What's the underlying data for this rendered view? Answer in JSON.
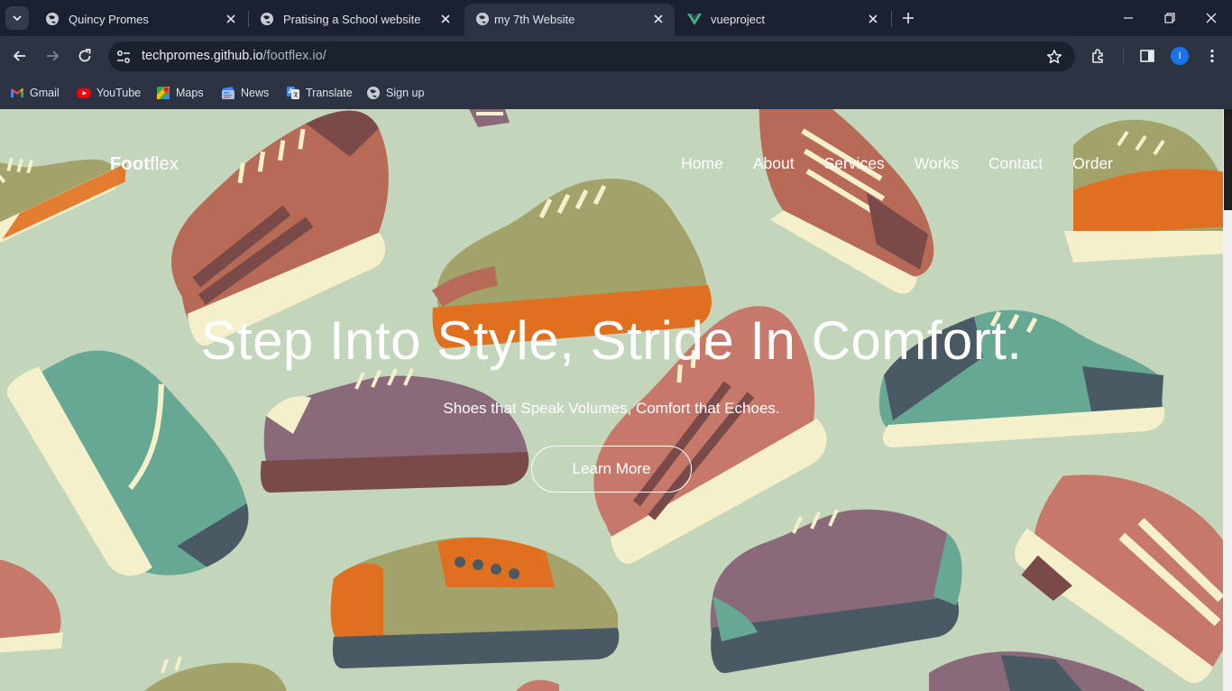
{
  "browser": {
    "tabs": [
      {
        "title": "Quincy Promes",
        "icon": "globe-icon"
      },
      {
        "title": "Pratising a School website",
        "icon": "globe-icon"
      },
      {
        "title": "my 7th Website",
        "icon": "globe-icon",
        "active": true
      },
      {
        "title": "vueproject",
        "icon": "vue-logo-icon"
      }
    ],
    "address": {
      "host": "techpromes.github.io",
      "path": "/footflex.io/"
    },
    "profile_initial": "I",
    "bookmarks": [
      {
        "label": "Gmail",
        "icon": "gmail-icon"
      },
      {
        "label": "YouTube",
        "icon": "youtube-icon"
      },
      {
        "label": "Maps",
        "icon": "maps-icon"
      },
      {
        "label": "News",
        "icon": "news-icon"
      },
      {
        "label": "Translate",
        "icon": "translate-icon"
      },
      {
        "label": "Sign up",
        "icon": "globe-icon"
      }
    ],
    "colors": {
      "tabstrip": "#1b2130",
      "toolbar": "#2c3444",
      "omnibox": "#1c2130",
      "profile": "#1a73e8"
    }
  },
  "site": {
    "brand_bold": "Foot",
    "brand_rest": "flex",
    "nav": [
      "Home",
      "About",
      "Services",
      "Works",
      "Contact",
      "Order"
    ],
    "hero": {
      "title": "Step Into Style, Stride In Comfort.",
      "subtitle": "Shoes that Speak Volumes, Comfort that Echoes.",
      "cta": "Learn More"
    },
    "colors": {
      "background": "#c3d5ba",
      "text": "#ffffff",
      "shoe_orange": "#e07020",
      "shoe_olive": "#a2a36a",
      "shoe_brick": "#b76a55",
      "shoe_purple": "#8a6a7a",
      "shoe_teal": "#67a894",
      "shoe_slate": "#4a5a64",
      "shoe_cream": "#f5f0cc"
    }
  }
}
